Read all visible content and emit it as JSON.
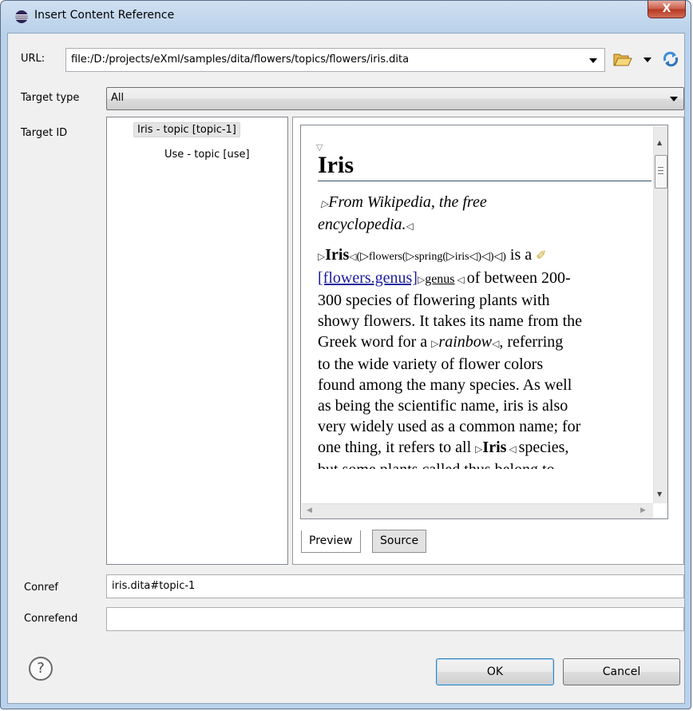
{
  "window": {
    "title": "Insert Content Reference",
    "close_label": "X"
  },
  "url": {
    "label": "URL:",
    "value": "file:/D:/projects/eXml/samples/dita/flowers/topics/flowers/iris.dita",
    "icons": [
      "folder-open-icon",
      "dropdown-arrow-icon",
      "refresh-icon"
    ]
  },
  "target_type": {
    "label": "Target type",
    "selected": "All"
  },
  "target_id": {
    "label": "Target ID",
    "items": [
      {
        "label": "Iris - topic [topic-1]",
        "selected": true
      },
      {
        "label": "Use - topic [use]",
        "selected": false
      }
    ]
  },
  "preview": {
    "title": "Iris",
    "subtitle_line1": "From Wikipedia, the free",
    "subtitle_line2": "encyclopedia.",
    "iris_word": "Iris",
    "markers": "(▷flowers(▷spring(▷iris◁)◁)◁)",
    "is_a": "is a",
    "link_text": "[flowers.genus]",
    "genus_word": "genus",
    "after_genus": "of between 200-",
    "lines": [
      "300 species of flowering plants with",
      "showy flowers. It takes its name from the"
    ],
    "rainbow_before": "Greek word for a",
    "rainbow_word": "rainbow",
    "rainbow_after": ", referring",
    "lines2": [
      "to the wide variety of flower colors",
      "found among the many species. As well",
      "as being the scientific name, iris is also",
      "very widely used as a common name; for"
    ],
    "last_before": "one thing, it refers to all",
    "last_iris": "Iris",
    "last_after": "species,",
    "cut_line": "but some plants called thus belong to"
  },
  "tabs": [
    {
      "label": "Preview",
      "active": true
    },
    {
      "label": "Source",
      "active": false
    }
  ],
  "conref": {
    "label": "Conref",
    "value": "iris.dita#topic-1"
  },
  "conrefend": {
    "label": "Conrefend",
    "value": ""
  },
  "buttons": {
    "ok": "OK",
    "cancel": "Cancel",
    "help": "?"
  }
}
